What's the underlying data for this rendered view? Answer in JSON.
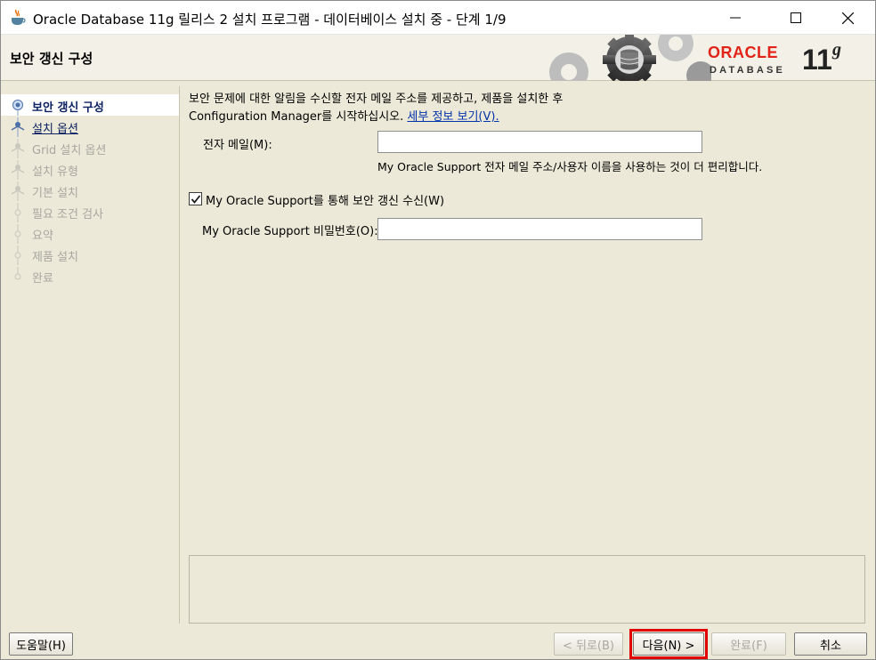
{
  "window": {
    "title": "Oracle Database 11g 릴리스 2 설치 프로그램 - 데이터베이스 설치 중 - 단계 1/9"
  },
  "header": {
    "title": "보안 갱신 구성",
    "logo_oracle": "ORACLE",
    "logo_database": "DATABASE",
    "logo_version": "11",
    "logo_version_suffix": "g"
  },
  "nav": {
    "items": [
      {
        "label": "보안 갱신 구성",
        "state": "active"
      },
      {
        "label": "설치 옵션",
        "state": "link"
      },
      {
        "label": "Grid 설치 옵션",
        "state": "disabled"
      },
      {
        "label": "설치 유형",
        "state": "disabled"
      },
      {
        "label": "기본 설치",
        "state": "disabled"
      },
      {
        "label": "필요 조건 검사",
        "state": "disabled"
      },
      {
        "label": "요약",
        "state": "disabled"
      },
      {
        "label": "제품 설치",
        "state": "disabled"
      },
      {
        "label": "완료",
        "state": "disabled"
      }
    ]
  },
  "main": {
    "intro_line1": "보안 문제에 대한 알림을 수신할 전자 메일 주소를 제공하고, 제품을 설치한 후",
    "intro_line2": "Configuration Manager를 시작하십시오. ",
    "details_link": "세부 정보 보기(V).",
    "email_label": "전자 메일(M):",
    "email_value": "",
    "email_hint": "My Oracle Support 전자 메일 주소/사용자 이름을 사용하는 것이 더 편리합니다.",
    "checkbox_label": "My Oracle Support를 통해 보안 갱신 수신(W)",
    "checkbox_checked": true,
    "password_label": "My Oracle Support 비밀번호(O):",
    "password_value": ""
  },
  "buttons": {
    "help": "도움말(H)",
    "back": "< 뒤로(B)",
    "next": "다음(N) >",
    "finish": "완료(F)",
    "cancel": "취소"
  },
  "colors": {
    "accent_red": "#e2231a",
    "nav_active_text": "#0b2161",
    "highlight": "#e00000"
  }
}
